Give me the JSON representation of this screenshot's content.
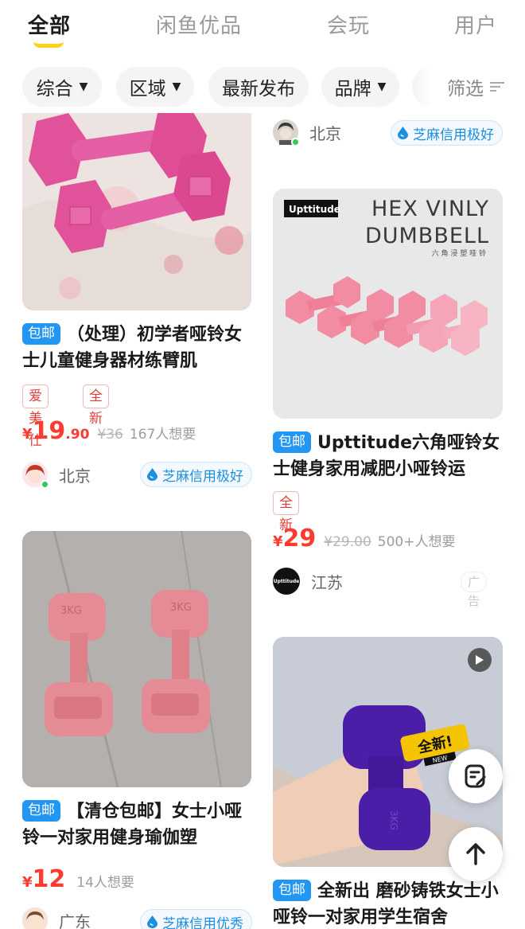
{
  "tabs": [
    {
      "label": "全部",
      "active": true
    },
    {
      "label": "闲鱼优品",
      "active": false
    },
    {
      "label": "会玩",
      "active": false
    },
    {
      "label": "用户",
      "active": false
    }
  ],
  "filters": [
    {
      "label": "综合",
      "dropdown": true
    },
    {
      "label": "区域",
      "dropdown": true
    },
    {
      "label": "最新发布",
      "dropdown": false
    },
    {
      "label": "品牌",
      "dropdown": true
    },
    {
      "label": "",
      "dropdown": false
    }
  ],
  "filter_button": "筛选",
  "colors": {
    "accent_yellow": "#ffd21a",
    "price_red": "#ff3b30",
    "free_shipping_blue": "#2196f3",
    "credit_blue": "#1d8fe0"
  },
  "left_column": [
    {
      "free_shipping": "包邮",
      "title": "（处理）初学者哑铃女士儿童健身器材练臂肌",
      "tags": [
        "爱美仕",
        "全新"
      ],
      "price_currency": "¥",
      "price_int": "19",
      "price_dec": ".90",
      "price_orig": "¥36",
      "wants": "167人想要",
      "seller_location": "北京",
      "credit": "芝麻信用极好"
    },
    {
      "free_shipping": "包邮",
      "title": "【清仓包邮】女士小哑铃一对家用健身瑜伽塑",
      "tags": [],
      "price_currency": "¥",
      "price_int": "12",
      "price_dec": "",
      "price_orig": "",
      "wants": "14人想要",
      "seller_location": "广东",
      "credit": "芝麻信用优秀",
      "image_text": [
        "3KG",
        "3KG"
      ]
    }
  ],
  "right_column": [
    {
      "seller_location": "北京",
      "credit": "芝麻信用极好"
    },
    {
      "image_brand": "Upttitude",
      "image_heading": [
        "HEX VINLY",
        "DUMBBELL"
      ],
      "image_subheading": "六 角 浸 塑 哑 铃",
      "free_shipping": "包邮",
      "title": "Upttitude六角哑铃女士健身家用减肥小哑铃运",
      "tags": [
        "全新"
      ],
      "price_currency": "¥",
      "price_int": "29",
      "price_dec": "",
      "price_orig": "¥29.00",
      "wants": "500+人想要",
      "seller_name": "Upttitude",
      "seller_location": "江苏",
      "ad_label": "广告"
    },
    {
      "image_sticker": "全新!",
      "image_sticker_sub": "NEW",
      "image_text": "3KG",
      "free_shipping": "包邮",
      "title": "全新出 磨砂铸铁女士小哑铃一对家用学生宿舍"
    }
  ],
  "icons": [
    "filter-icon",
    "play-icon",
    "post-icon",
    "back-to-top-icon",
    "credit-drop-icon"
  ]
}
